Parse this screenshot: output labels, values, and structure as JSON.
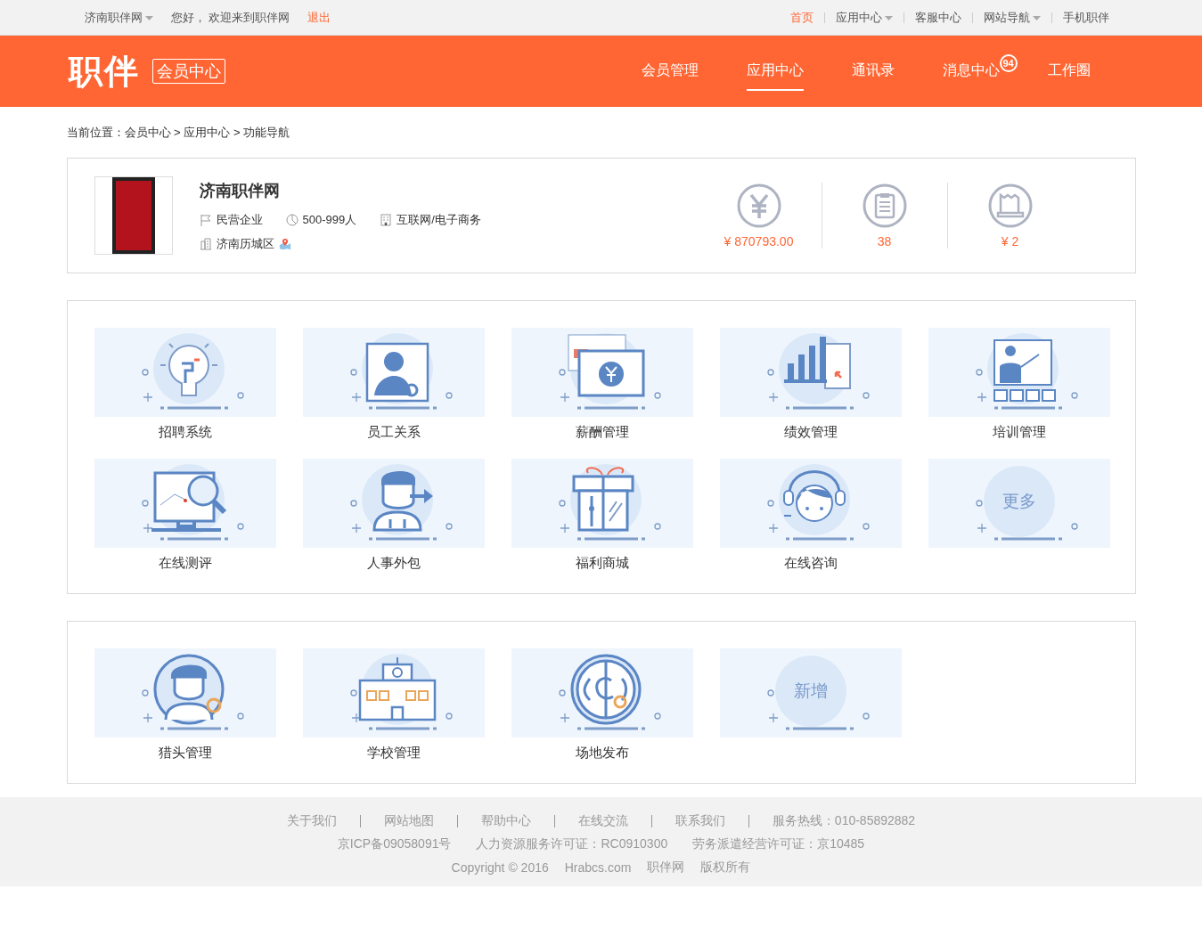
{
  "top_bar": {
    "left": [
      {
        "label": "济南职伴网",
        "dropdown": true,
        "highlighted": false
      },
      {
        "label": "您好， 欢迎来到职伴网",
        "dropdown": false,
        "highlighted": false
      },
      {
        "label": "退出",
        "dropdown": false,
        "highlighted": true
      }
    ],
    "right": [
      {
        "label": "首页",
        "dropdown": false,
        "selected": true
      },
      {
        "label": "应用中心",
        "dropdown": true,
        "selected": false
      },
      {
        "label": "客服中心",
        "dropdown": false,
        "selected": false
      },
      {
        "label": "网站导航",
        "dropdown": true,
        "selected": false
      },
      {
        "label": "手机职伴",
        "dropdown": false,
        "selected": false
      }
    ]
  },
  "header": {
    "logo": "职伴",
    "subtitle": "会员中心",
    "nav": [
      {
        "label": "会员管理",
        "selected": false
      },
      {
        "label": "应用中心",
        "selected": true
      },
      {
        "label": "通讯录",
        "selected": false
      },
      {
        "label": "消息中心",
        "selected": false,
        "badge": "94"
      },
      {
        "label": "工作圈",
        "selected": false
      }
    ]
  },
  "breadcrumb": "当前位置：会员中心 > 应用中心 > 功能导航",
  "company": {
    "name": "济南职伴网",
    "tags": [
      "民营企业",
      "500-999人",
      "互联网/电子商务"
    ],
    "location": "济南历城区",
    "stats": [
      "¥ 870793.00",
      "38",
      "¥ 2"
    ]
  },
  "panels": [
    {
      "tiles": [
        {
          "kind": "app",
          "label": "招聘系统"
        },
        {
          "kind": "app",
          "label": "员工关系"
        },
        {
          "kind": "app",
          "label": "薪酬管理"
        },
        {
          "kind": "app",
          "label": "绩效管理"
        },
        {
          "kind": "app",
          "label": "培训管理"
        },
        {
          "kind": "app",
          "label": "在线测评"
        },
        {
          "kind": "app",
          "label": "人事外包"
        },
        {
          "kind": "app",
          "label": "福利商城"
        },
        {
          "kind": "app",
          "label": "在线咨询"
        },
        {
          "kind": "text",
          "label": "更多"
        }
      ]
    },
    {
      "tiles": [
        {
          "kind": "app",
          "label": "猎头管理"
        },
        {
          "kind": "app",
          "label": "学校管理"
        },
        {
          "kind": "app",
          "label": "场地发布"
        },
        {
          "kind": "text",
          "label": "新增"
        }
      ]
    }
  ],
  "footer": {
    "links": [
      "关于我们",
      "网站地图",
      "帮助中心",
      "在线交流",
      "联系我们",
      "服务热线：010-85892882"
    ],
    "licenses": [
      "京ICP备09058091号",
      "人力资源服务许可证：RC0910300",
      "劳务派遣经营许可证：京10485"
    ],
    "copyright": [
      "Copyright © 2016",
      "Hrabcs.com",
      "职伴网",
      "版权所有"
    ]
  }
}
